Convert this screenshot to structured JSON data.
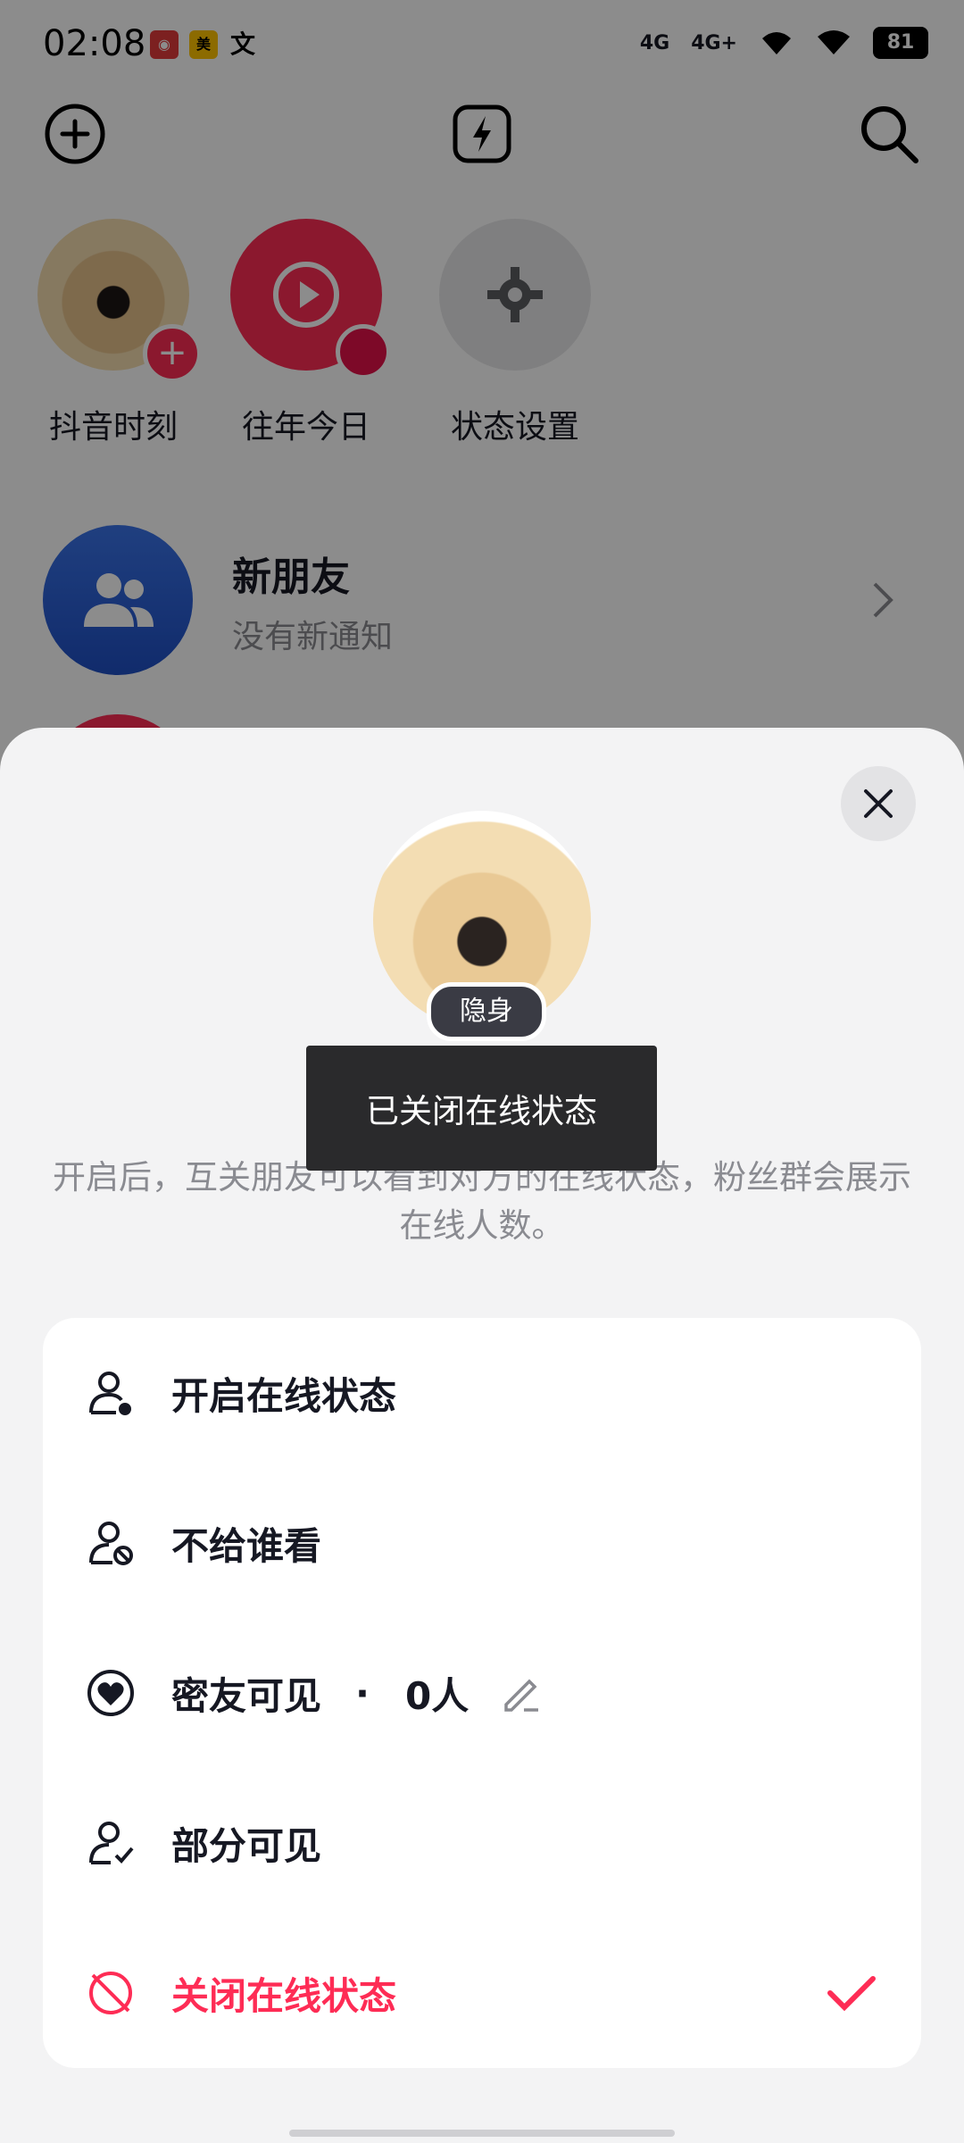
{
  "status_bar": {
    "time": "02:08",
    "battery": "81",
    "network_1": "4G",
    "network_2": "4G+",
    "notif_icons": [
      "netease-music-icon",
      "meituan-icon",
      "translate-icon"
    ]
  },
  "top_bar": {
    "icons": [
      "add-icon",
      "flash-icon",
      "search-icon"
    ]
  },
  "stories": [
    {
      "label": "抖音时刻"
    },
    {
      "label": "往年今日"
    },
    {
      "label": "状态设置"
    }
  ],
  "friend": {
    "title": "新朋友",
    "subtitle": "没有新通知"
  },
  "sheet": {
    "badge": "隐身",
    "title": "在线状态",
    "description": "开启后，互关朋友可以看到对方的在线状态，粉丝群会展示在线人数。",
    "toast": "已关闭在线状态",
    "options": [
      {
        "label": "开启在线状态"
      },
      {
        "label": "不给谁看"
      },
      {
        "label": "密友可见",
        "dot": "·",
        "count": "0人"
      },
      {
        "label": "部分可见"
      },
      {
        "label": "关闭在线状态",
        "selected": true
      }
    ]
  },
  "colors": {
    "accent": "#fe2c55",
    "sheet_bg": "#f3f3f4",
    "friend_blue": "#2b5fd9"
  }
}
